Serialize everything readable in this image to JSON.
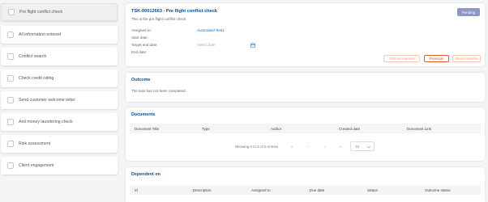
{
  "sidebar": {
    "steps": [
      {
        "label": "Pre flight conflict check"
      },
      {
        "label": "All information entered"
      },
      {
        "label": "Conflict search"
      },
      {
        "label": "Check credit rating"
      },
      {
        "label": "Send customer welcome letter"
      },
      {
        "label": "Anti money laundering check"
      },
      {
        "label": "Risk assessment"
      },
      {
        "label": "Client engagement"
      }
    ]
  },
  "task": {
    "title": "TSK-00012663 - Pre flight conflict check",
    "description": "This is the pre flight conflict check",
    "status": "Pending",
    "status_color": "#8f97c9",
    "fields": {
      "assigned_to_label": "Assigned to:",
      "assigned_to_value": "Automated Test1",
      "start_date_label": "Start date:",
      "target_end_date_label": "Target end date:",
      "target_end_date_placeholder": "Select date",
      "end_date_label": "End date:"
    },
    "buttons": {
      "not_required": "Task not required",
      "reassign": "Reassign",
      "mark_complete": "Mark complete"
    }
  },
  "outcome": {
    "title": "Outcome",
    "text": "The task has not been completed."
  },
  "documents": {
    "title": "Documents",
    "columns": [
      "Document Title",
      "Type",
      "Author",
      "Created date",
      "Document Link"
    ],
    "pager": {
      "summary": "Showing 0 to 0 of 0 entries",
      "first": "«",
      "prev": "‹",
      "next": "›",
      "last": "»",
      "page_size": "10"
    }
  },
  "dependent": {
    "title": "Dependent on",
    "columns": [
      "Id",
      "Description",
      "Assigned to",
      "Due date",
      "Status",
      "Outcome status"
    ]
  },
  "icons": {
    "calendar": "calendar-icon",
    "chevron": "chevron-down-icon"
  }
}
